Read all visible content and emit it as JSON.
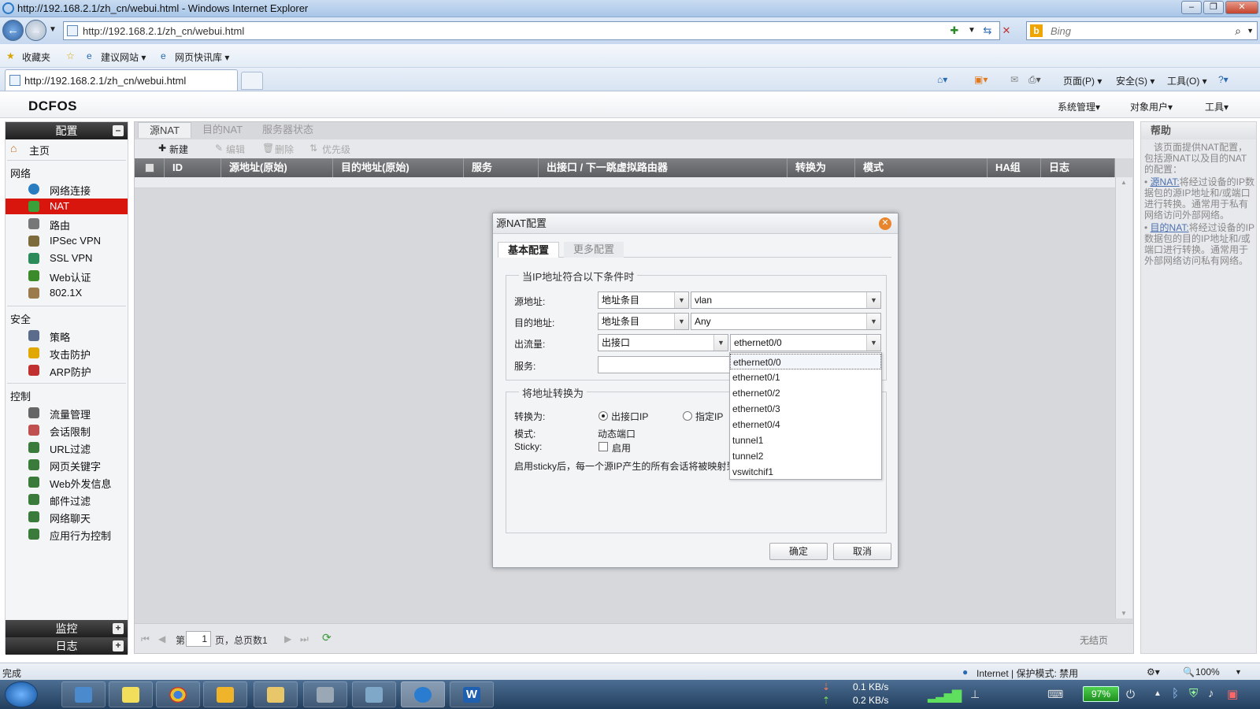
{
  "browser": {
    "title": "http://192.168.2.1/zh_cn/webui.html - Windows Internet Explorer",
    "url": "http://192.168.2.1/zh_cn/webui.html",
    "search_placeholder": "Bing",
    "favorites": [
      "收藏夹",
      "建议网站 ▾",
      "网页快讯库 ▾"
    ],
    "tab_url": "http://192.168.2.1/zh_cn/webui.html",
    "commands": [
      "页面(P) ▾",
      "安全(S) ▾",
      "工具(O) ▾"
    ],
    "status_left": "完成",
    "status_zone": "Internet | 保护模式: 禁用",
    "zoom": "100%"
  },
  "app": {
    "logo": "DCFOS",
    "top_menu": [
      "系统管理▾",
      "对象用户▾",
      "工具▾"
    ]
  },
  "sidebar": {
    "header": "配置",
    "sections": {
      "network": "网络",
      "security": "安全",
      "control": "控制"
    },
    "home": "主页",
    "items": [
      {
        "label": "网络连接",
        "color": "#2a7cc0"
      },
      {
        "label": "NAT",
        "color": "#3aa13a"
      },
      {
        "label": "路由",
        "color": "#777777"
      },
      {
        "label": "IPSec VPN",
        "color": "#7d6b3b"
      },
      {
        "label": "SSL VPN",
        "color": "#2b8a5a"
      },
      {
        "label": "Web认证",
        "color": "#3b8b2b"
      },
      {
        "label": "802.1X",
        "color": "#9b7b4b"
      },
      {
        "label": "策略",
        "color": "#5b6b8b"
      },
      {
        "label": "攻击防护",
        "color": "#e0a800"
      },
      {
        "label": "ARP防护",
        "color": "#c03030"
      },
      {
        "label": "流量管理",
        "color": "#666666"
      },
      {
        "label": "会话限制",
        "color": "#c05050"
      },
      {
        "label": "URL过滤",
        "color": "#3a7a3a"
      },
      {
        "label": "网页关键字",
        "color": "#3a7a3a"
      },
      {
        "label": "Web外发信息",
        "color": "#3a7a3a"
      },
      {
        "label": "邮件过滤",
        "color": "#3a7a3a"
      },
      {
        "label": "网络聊天",
        "color": "#3a7a3a"
      },
      {
        "label": "应用行为控制",
        "color": "#3a7a3a"
      }
    ],
    "monitor": "监控",
    "log": "日志"
  },
  "main": {
    "tabs": [
      "源NAT",
      "目的NAT",
      "服务器状态"
    ],
    "toolbar": [
      "新建",
      "编辑",
      "删除",
      "优先级"
    ],
    "columns": [
      "ID",
      "源地址(原始)",
      "目的地址(原始)",
      "服务",
      "出接口 / 下一跳虚拟路由器",
      "转换为",
      "模式",
      "HA组",
      "日志"
    ],
    "pager": {
      "page_prefix": "第",
      "page_value": "1",
      "page_suffix": "页，总页数1",
      "empty": "无结页"
    }
  },
  "help": {
    "title": "帮助",
    "intro": "该页面提供NAT配置，包括源NAT以及目的NAT的配置：",
    "snat_link": "源NAT:",
    "snat_text": "将经过设备的IP数据包的源IP地址和/或端口进行转换。通常用于私有网络访问外部网络。",
    "dnat_link": "目的NAT:",
    "dnat_text": "将经过设备的IP数据包的目的IP地址和/或端口进行转换。通常用于外部网络访问私有网络。"
  },
  "modal": {
    "title": "源NAT配置",
    "tabs": [
      "基本配置",
      "更多配置"
    ],
    "condition_legend": "当IP地址符合以下条件时",
    "src_label": "源地址:",
    "src_type": "地址条目",
    "src_value": "vlan",
    "dst_label": "目的地址:",
    "dst_type": "地址条目",
    "dst_value": "Any",
    "egress_label": "出流量:",
    "egress_type": "出接口",
    "egress_value": "ethernet0/0",
    "service_label": "服务:",
    "translate_legend": "将地址转换为",
    "translate_label": "转换为:",
    "opt_egress_ip": "出接口IP",
    "opt_specified_ip": "指定IP",
    "mode_label": "模式:",
    "mode_value": "动态端口",
    "sticky_label": "Sticky:",
    "sticky_option": "启用",
    "sticky_note": "启用sticky后，每一个源IP产生的所有会话将被映射到",
    "ok": "确定",
    "cancel": "取消",
    "dropdown_options": [
      "ethernet0/0",
      "ethernet0/1",
      "ethernet0/2",
      "ethernet0/3",
      "ethernet0/4",
      "tunnel1",
      "tunnel2",
      "vswitchif1"
    ]
  },
  "taskbar": {
    "down_rate": "0.1 KB/s",
    "up_rate": "0.2 KB/s",
    "battery": "97%"
  }
}
